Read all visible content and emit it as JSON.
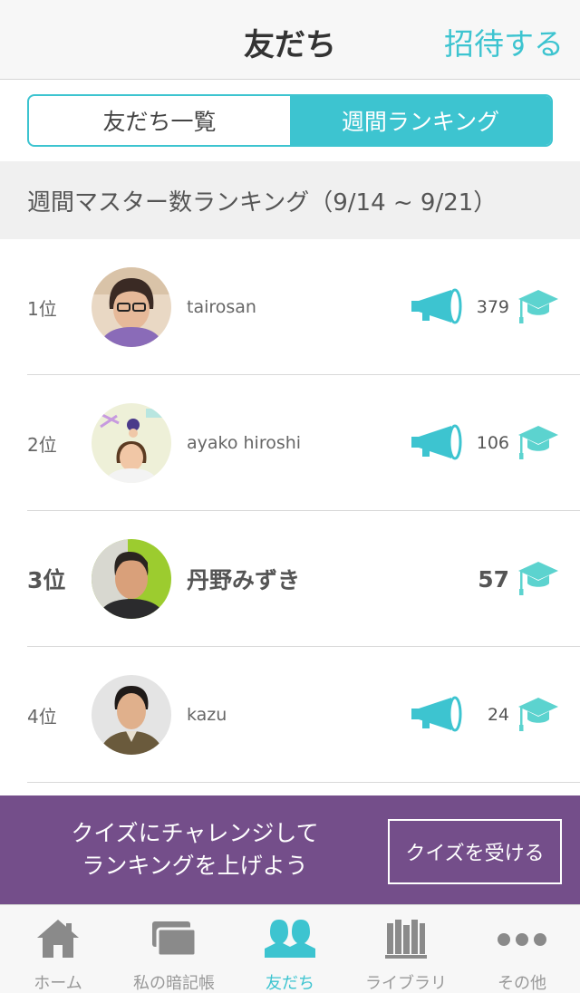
{
  "header": {
    "title": "友だち",
    "invite_label": "招待する"
  },
  "segment": {
    "items": [
      {
        "label": "友だち一覧",
        "active": false
      },
      {
        "label": "週間ランキング",
        "active": true
      }
    ]
  },
  "section": {
    "title": "週間マスター数ランキング（9/14 ~ 9/21）"
  },
  "ranking": [
    {
      "position": "1位",
      "name": "tairosan",
      "score": "379",
      "has_megaphone": true,
      "is_me": false
    },
    {
      "position": "2位",
      "name": "ayako hiroshi",
      "score": "106",
      "has_megaphone": true,
      "is_me": false
    },
    {
      "position": "3位",
      "name": "丹野みずき",
      "score": "57",
      "has_megaphone": false,
      "is_me": true
    },
    {
      "position": "4位",
      "name": "kazu",
      "score": "24",
      "has_megaphone": true,
      "is_me": false
    }
  ],
  "banner": {
    "line1": "クイズにチャレンジして",
    "line2": "ランキングを上げよう",
    "button_label": "クイズを受ける"
  },
  "tabbar": {
    "items": [
      {
        "label": "ホーム",
        "icon": "home-icon",
        "active": false
      },
      {
        "label": "私の暗記帳",
        "icon": "cards-icon",
        "active": false
      },
      {
        "label": "友だち",
        "icon": "friends-icon",
        "active": true
      },
      {
        "label": "ライブラリ",
        "icon": "library-icon",
        "active": false
      },
      {
        "label": "その他",
        "icon": "more-icon",
        "active": false
      }
    ]
  },
  "colors": {
    "accent": "#3dc4d0",
    "banner": "#744e8a",
    "icon_gray": "#8a8a8a"
  }
}
